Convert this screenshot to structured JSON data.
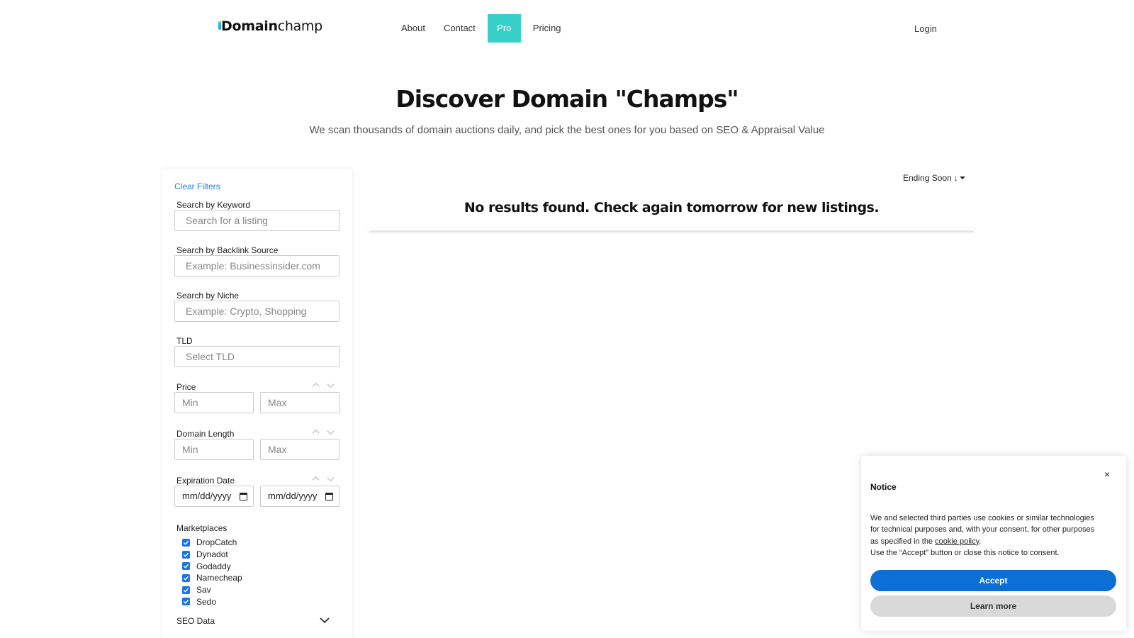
{
  "header": {
    "logo_prefix": "D",
    "logo_bold": "omain",
    "logo_rest": "champ",
    "nav": [
      {
        "label": "About"
      },
      {
        "label": "Contact"
      },
      {
        "label": "Pro"
      },
      {
        "label": "Pricing"
      }
    ],
    "login": "Login"
  },
  "hero": {
    "title": "Discover Domain \"Champs\"",
    "subtitle": "We scan thousands of domain auctions daily, and pick the best ones for you based on SEO & Appraisal Value"
  },
  "filters": {
    "clear": "Clear Filters",
    "keyword": {
      "label": "Search by Keyword",
      "placeholder": "Search for a listing"
    },
    "backlink": {
      "label": "Search by Backlink Source",
      "placeholder": "Example: Businessinsider.com"
    },
    "niche": {
      "label": "Search by Niche",
      "placeholder": "Example: Crypto, Shopping"
    },
    "tld": {
      "label": "TLD",
      "placeholder": "Select TLD"
    },
    "price": {
      "label": "Price",
      "min": "Min",
      "max": "Max"
    },
    "length": {
      "label": "Domain Length",
      "min": "Min",
      "max": "Max"
    },
    "expiration": {
      "label": "Expiration Date",
      "from": "mm/dd/yyyy",
      "to": "mm/dd/yyyy"
    },
    "marketplaces": {
      "label": "Marketplaces",
      "items": [
        {
          "label": "DropCatch",
          "checked": true
        },
        {
          "label": "Dynadot",
          "checked": true
        },
        {
          "label": "Godaddy",
          "checked": true
        },
        {
          "label": "Namecheap",
          "checked": true
        },
        {
          "label": "Sav",
          "checked": true
        },
        {
          "label": "Sedo",
          "checked": true
        }
      ]
    },
    "seo": {
      "label": "SEO Data"
    }
  },
  "results": {
    "sort_label": "Ending Soon",
    "sort_arrow": "↓",
    "empty_message": "No results found. Check again tomorrow for new listings."
  },
  "notice": {
    "close": "×",
    "title": "Notice",
    "body_1": "We and selected third parties use cookies or similar technologies for technical purposes and, with your consent, for other purposes as specified in the ",
    "link": "cookie policy",
    "body_2": ".",
    "body_3": "Use the “Accept” button or close this notice to consent.",
    "accept": "Accept",
    "learn_more": "Learn more"
  },
  "colors": {
    "brand_teal": "#36cfc9",
    "link_blue": "#2d7de0",
    "accept_blue": "#0b6fd6"
  }
}
